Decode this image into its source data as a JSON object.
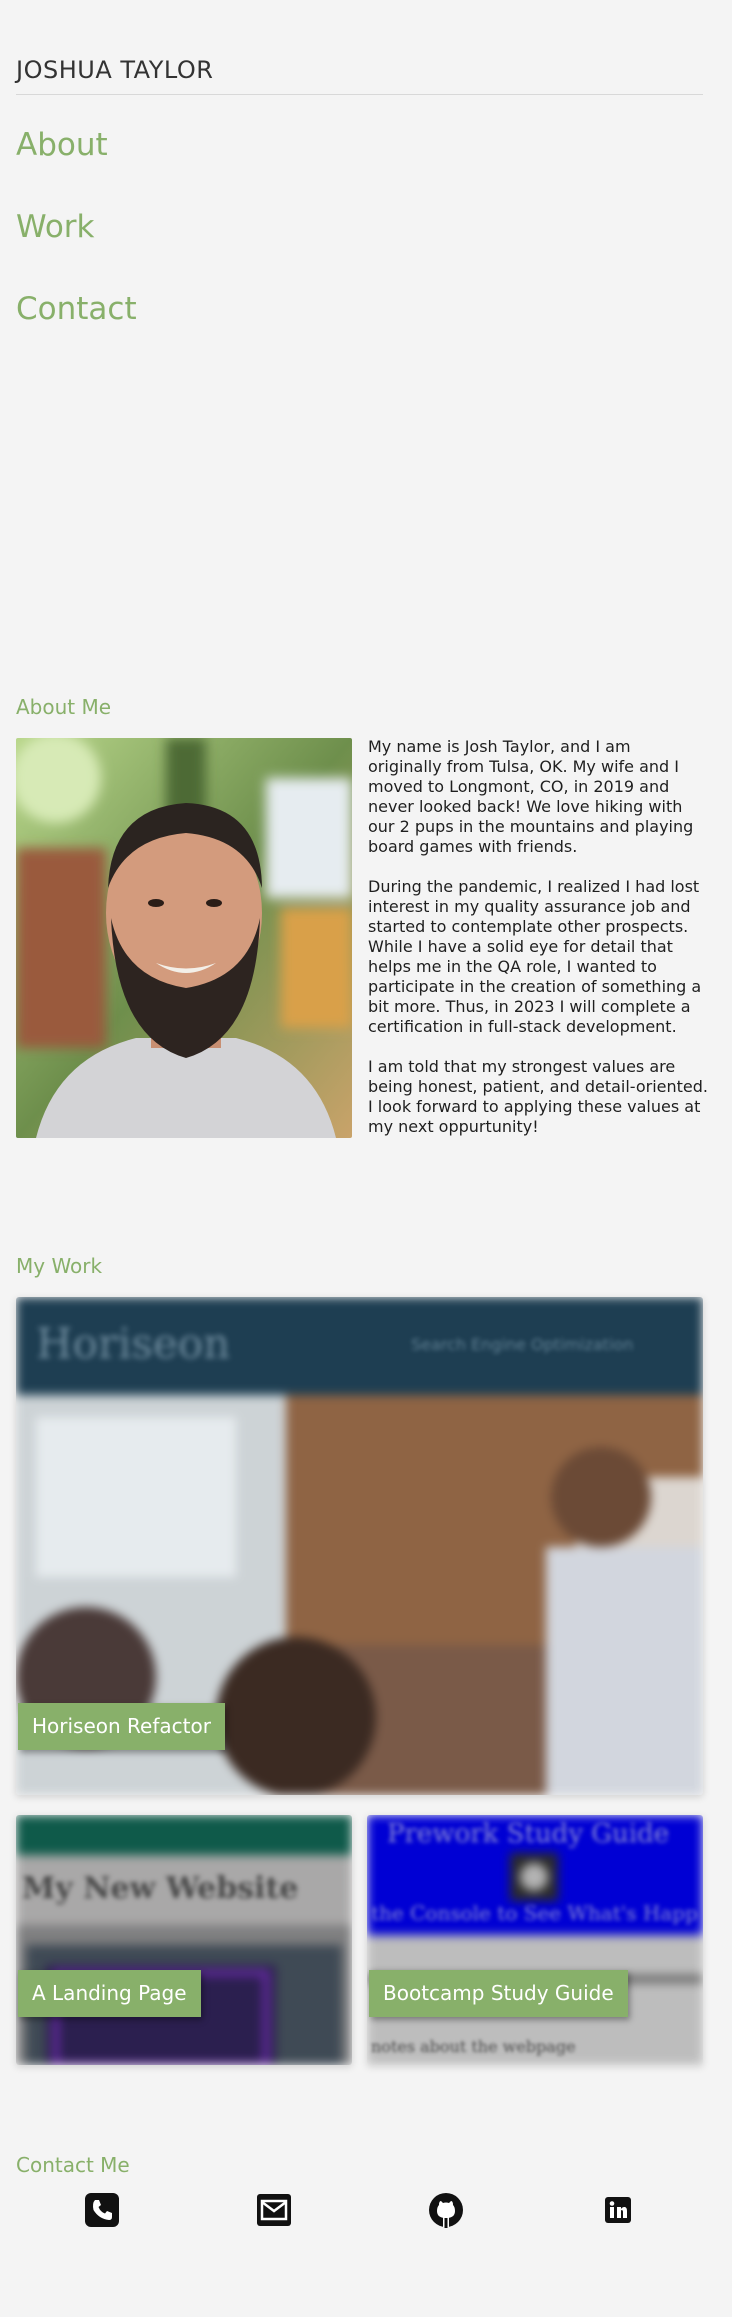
{
  "header": {
    "name": "JOSHUA TAYLOR"
  },
  "nav": {
    "about": "About",
    "work": "Work",
    "contact": "Contact"
  },
  "about": {
    "title": "About Me",
    "photo_alt": "Josh Taylor portrait",
    "paragraphs": [
      "My name is Josh Taylor, and I am originally from Tulsa, OK. My wife and I moved to Longmont, CO, in 2019 and never looked back! We love hiking with our 2 pups in the mountains and playing board games with friends.",
      "During the pandemic, I realized I had lost interest in my quality assurance job and started to contemplate other prospects. While I have a solid eye for detail that helps me in the QA role, I wanted to participate in the creation of something a bit more. Thus, in 2023 I will complete a certification in full-stack development.",
      "I am told that my strongest values are being honest, patient, and detail-oriented. I look forward to applying these values at my next oppurtunity!"
    ]
  },
  "work": {
    "title": "My Work",
    "projects": [
      {
        "label": "Horiseon Refactor",
        "screenshot_title": "Horiseon",
        "screenshot_nav": "Search Engine Optimization"
      },
      {
        "label": "A Landing Page",
        "screenshot_title": "My New Website"
      },
      {
        "label": "Bootcamp Study Guide",
        "screenshot_title": "Prework Study Guide",
        "screenshot_subtitle": "the Console to See What's Happ",
        "screenshot_text": "notes about the webpage"
      }
    ]
  },
  "contact": {
    "title": "Contact Me",
    "icons": [
      "phone-icon",
      "email-icon",
      "github-icon",
      "linkedin-icon"
    ]
  },
  "colors": {
    "accent": "#88b06a",
    "background": "#f4f4f4",
    "horiseon_header": "#1e3e52",
    "study_guide_blue": "#0000d4"
  }
}
